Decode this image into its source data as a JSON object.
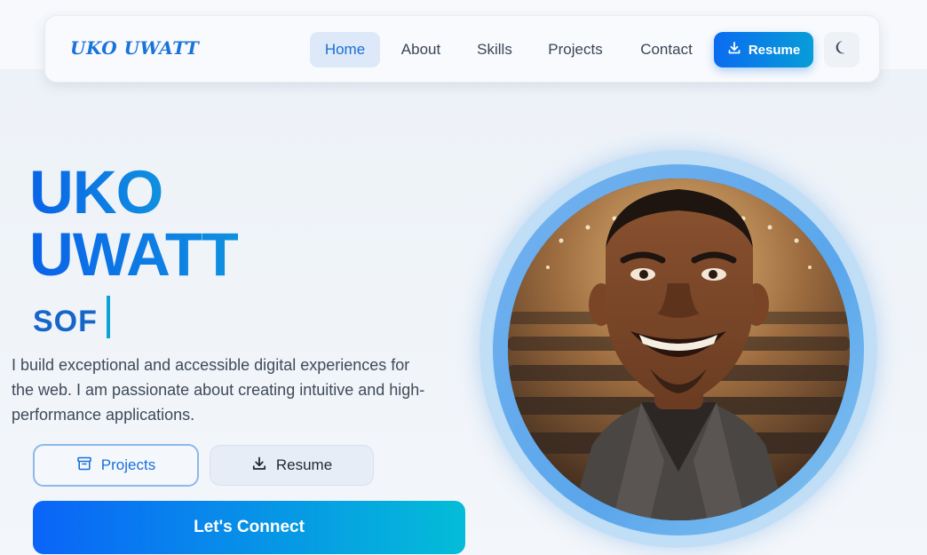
{
  "nav": {
    "logo": "UKO UWATT",
    "links": [
      "Home",
      "About",
      "Skills",
      "Projects",
      "Contact"
    ],
    "active": "Home",
    "resume_label": "Resume",
    "theme_icon": "moon-icon"
  },
  "hero": {
    "name_line1": "UKO",
    "name_line2": "UWATT",
    "typed_text": "SOF",
    "intro": "I build exceptional and accessible digital experiences for the web. I am passionate about creating intuitive and high-performance applications.",
    "projects_button": "Projects",
    "resume_button": "Resume",
    "connect_button": "Let's Connect"
  },
  "colors": {
    "accent": "#1a6fd6",
    "gradient_start": "#0a64f8",
    "gradient_end": "#04bdd8"
  },
  "icons": {
    "projects": "archive-box-icon",
    "resume": "download-icon",
    "portrait": "profile-portrait"
  }
}
